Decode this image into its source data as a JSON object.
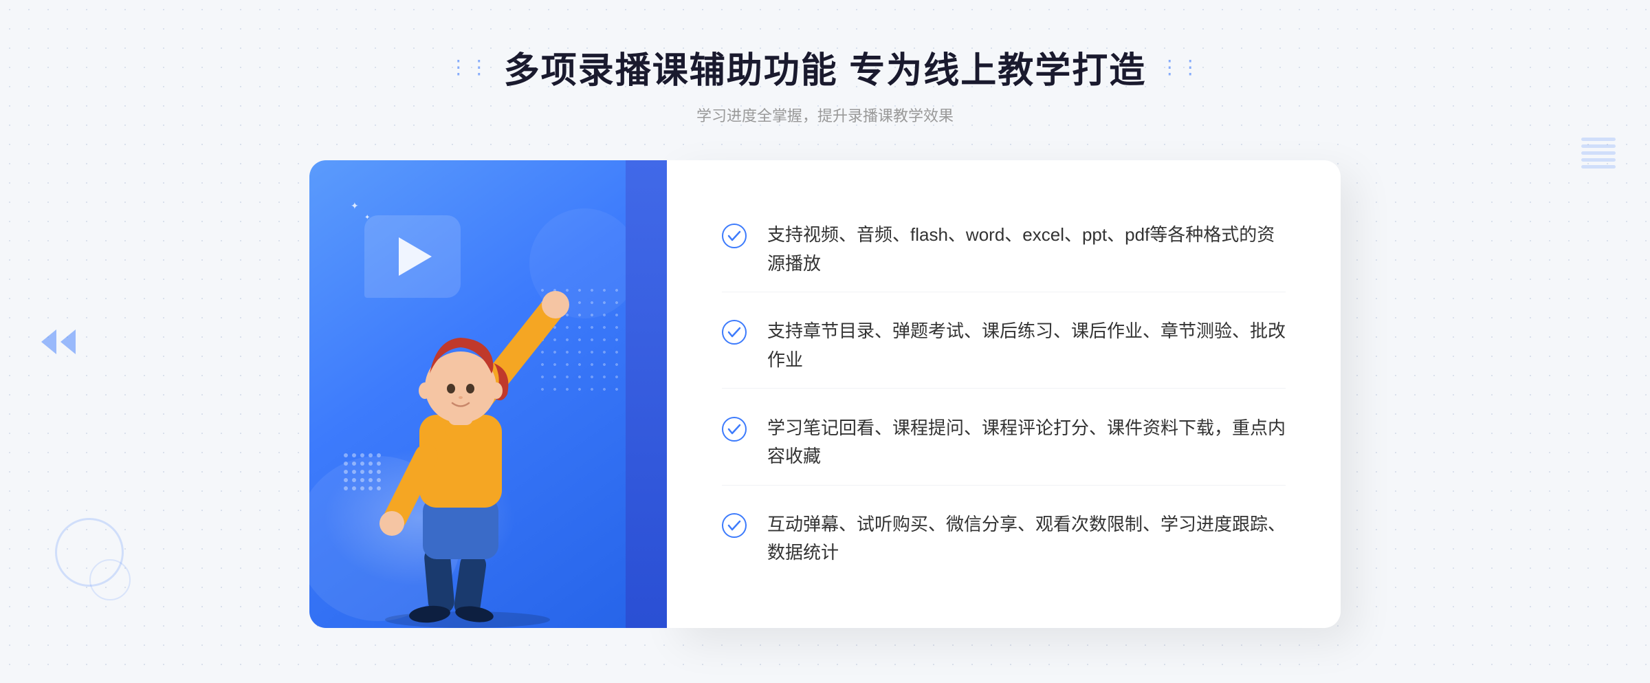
{
  "page": {
    "background_dots_color": "#d0d8e8"
  },
  "header": {
    "title": "多项录播课辅助功能 专为线上教学打造",
    "subtitle": "学习进度全掌握，提升录播课教学效果",
    "title_dots_left": "⁚⁚",
    "title_dots_right": "⁚⁚"
  },
  "features": [
    {
      "id": 1,
      "text": "支持视频、音频、flash、word、excel、ppt、pdf等各种格式的资源播放"
    },
    {
      "id": 2,
      "text": "支持章节目录、弹题考试、课后练习、课后作业、章节测验、批改作业"
    },
    {
      "id": 3,
      "text": "学习笔记回看、课程提问、课程评论打分、课件资料下载，重点内容收藏"
    },
    {
      "id": 4,
      "text": "互动弹幕、试听购买、微信分享、观看次数限制、学习进度跟踪、数据统计"
    }
  ],
  "illustration": {
    "play_button_label": "play",
    "figure_label": "teaching figure"
  },
  "colors": {
    "primary_blue": "#3d7bfc",
    "dark_blue": "#2a4fd4",
    "text_dark": "#1a1a2e",
    "text_gray": "#999999",
    "text_body": "#333333",
    "white": "#ffffff",
    "check_color": "#3d7bfc",
    "border_light": "#f0f2f5"
  }
}
